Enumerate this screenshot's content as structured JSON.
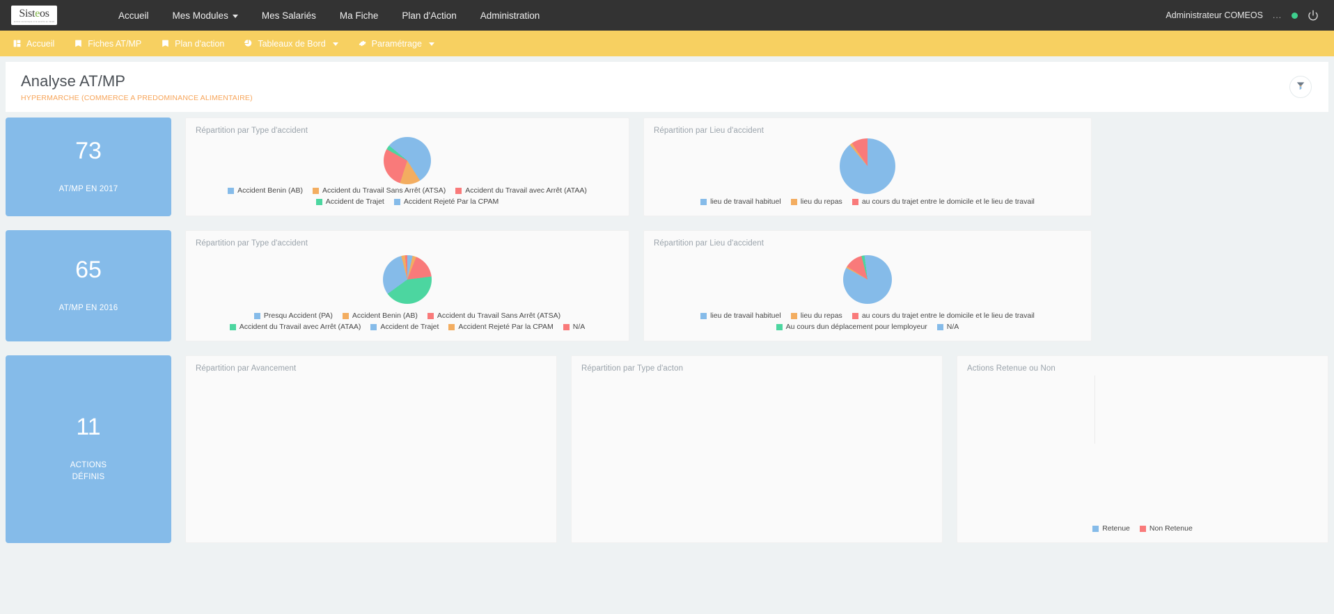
{
  "topnav": {
    "logo": {
      "text": "Sist",
      "accent": "e",
      "text2": "os",
      "tagline": "service economique et la securite au travail"
    },
    "items": [
      {
        "label": "Accueil",
        "has_caret": false
      },
      {
        "label": "Mes Modules",
        "has_caret": true
      },
      {
        "label": "Mes Salariés",
        "has_caret": false
      },
      {
        "label": "Ma Fiche",
        "has_caret": false
      },
      {
        "label": "Plan d'Action",
        "has_caret": false
      },
      {
        "label": "Administration",
        "has_caret": false
      }
    ],
    "user": "Administrateur COMEOS",
    "ellipsis": "...",
    "status_color": "#3ecf8e",
    "power_icon": "power-icon"
  },
  "subnav": {
    "background": "#f7d061",
    "items": [
      {
        "label": "Accueil",
        "icon": "dashboard-icon",
        "has_caret": false
      },
      {
        "label": "Fiches AT/MP",
        "icon": "book-icon",
        "has_caret": false
      },
      {
        "label": "Plan d'action",
        "icon": "book-icon",
        "has_caret": false
      },
      {
        "label": "Tableaux de Bord",
        "icon": "pie-chart-icon",
        "has_caret": true
      },
      {
        "label": "Paramétrage",
        "icon": "gear-icon",
        "has_caret": true
      }
    ]
  },
  "page": {
    "title": "Analyse AT/MP",
    "subtitle": "HYPERMARCHE (COMMERCE A PREDOMINANCE ALIMENTAIRE)",
    "filter_icon": "filter-icon"
  },
  "kpis": [
    {
      "value": "73",
      "label": "AT/MP EN 2017"
    },
    {
      "value": "65",
      "label": "AT/MP EN 2016"
    },
    {
      "value": "11",
      "label": "ACTIONS\nDÉFINIS",
      "line1": "ACTIONS",
      "line2": "DÉFINIS"
    }
  ],
  "palette": {
    "blue": "#85bbe9",
    "orange": "#f3ad60",
    "red": "#f97a7a",
    "green": "#4cd6a0",
    "card_blue": "#85bbe9"
  },
  "chart_data": [
    {
      "id": "type-accident-2017",
      "type": "pie",
      "title": "Répartition par Type d'accident",
      "legend_position": "bottom",
      "categories": [
        "Accident Benin (AB)",
        "Accident du Travail Sans Arrêt (ATSA)",
        "Accident du Travail avec Arrêt (ATAA)",
        "Accident de Trajet",
        "Accident Rejeté Par la CPAM"
      ],
      "colors": [
        "#85bbe9",
        "#f3ad60",
        "#f97a7a",
        "#4cd6a0",
        "#85bbe9"
      ],
      "values": [
        41,
        14,
        28,
        3,
        14
      ]
    },
    {
      "id": "lieu-accident-2017",
      "type": "pie",
      "title": "Répartition par Lieu d'accident",
      "legend_position": "bottom",
      "categories": [
        "lieu de travail habituel",
        "lieu du repas",
        "au cours du trajet entre le domicile et le lieu de travail"
      ],
      "colors": [
        "#85bbe9",
        "#f3ad60",
        "#f97a7a"
      ],
      "values": [
        89,
        1.5,
        9.5
      ]
    },
    {
      "id": "type-accident-2016",
      "type": "pie",
      "title": "Répartition par Type d'accident",
      "legend_position": "bottom",
      "categories": [
        "Presqu Accident (PA)",
        "Accident Benin (AB)",
        "Accident du Travail Sans Arrêt (ATSA)",
        "Accident du Travail avec Arrêt (ATAA)",
        "Accident de Trajet",
        "Accident Rejeté Par la CPAM",
        "N/A"
      ],
      "colors": [
        "#85bbe9",
        "#f3ad60",
        "#f97a7a",
        "#4cd6a0",
        "#85bbe9",
        "#f3ad60",
        "#f97a7a"
      ],
      "values": [
        3.5,
        2.5,
        17,
        42,
        31,
        2.5,
        1.5
      ]
    },
    {
      "id": "lieu-accident-2016",
      "type": "pie",
      "title": "Répartition par Lieu d'accident",
      "legend_position": "bottom",
      "categories": [
        "lieu de travail habituel",
        "lieu du repas",
        "au cours du trajet entre le domicile et le lieu de travail",
        "Au cours dun déplacement pour lemployeur",
        "N/A"
      ],
      "colors": [
        "#85bbe9",
        "#f3ad60",
        "#f97a7a",
        "#4cd6a0",
        "#85bbe9"
      ],
      "values": [
        83,
        1,
        12,
        2,
        2
      ]
    },
    {
      "id": "avancement",
      "type": "pie",
      "title": "Répartition par Avancement",
      "legend_position": "bottom",
      "categories": [],
      "colors": [],
      "values": []
    },
    {
      "id": "type-action",
      "type": "pie",
      "title": "Répartition par Type d'acton",
      "legend_position": "bottom",
      "categories": [],
      "colors": [],
      "values": []
    },
    {
      "id": "actions-retenue",
      "type": "bar",
      "title": "Actions Retenue ou Non",
      "legend_position": "bottom",
      "categories": [
        "Retenue",
        "Non Retenue"
      ],
      "colors": [
        "#85bbe9",
        "#f97a7a"
      ],
      "values": [
        null,
        null
      ]
    }
  ]
}
